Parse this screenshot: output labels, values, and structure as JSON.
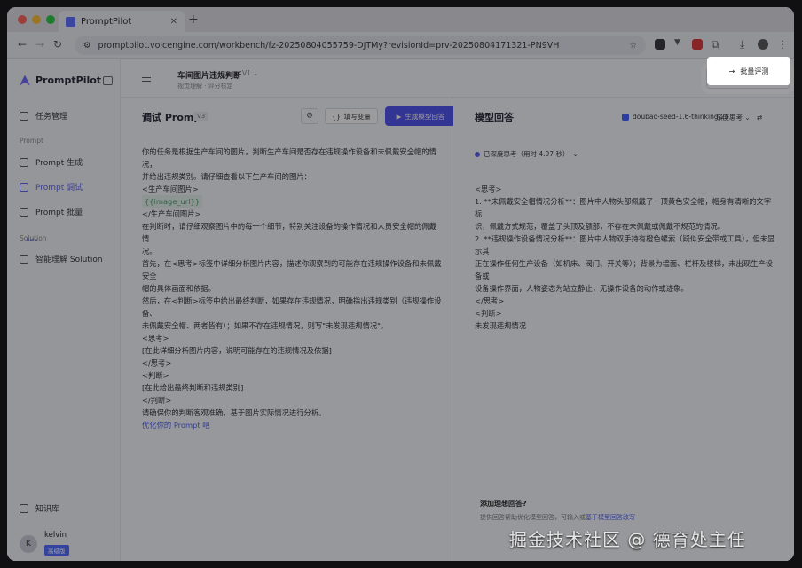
{
  "browser": {
    "tab_title": "PromptPilot",
    "url": "promptpilot.volcengine.com/workbench/fz-20250804055759-DJTMy?revisionId=prv-20250804171321-PN9VH"
  },
  "sidebar": {
    "brand": "PromptPilot",
    "items": [
      {
        "label": "任务管理"
      },
      {
        "label": "Prompt 生成"
      },
      {
        "label": "Prompt 调试"
      },
      {
        "label": "Prompt 批量"
      },
      {
        "label": "智能理解 Solution"
      },
      {
        "label": "知识库"
      }
    ],
    "sections": {
      "prompt": "Prompt",
      "solution": "Solution"
    },
    "beta": "beta",
    "user": {
      "name": "kelvin",
      "initial": "K",
      "badge": "高级版"
    }
  },
  "header": {
    "title": "车间图片违规判断",
    "version": "V1",
    "subtitle": "视觉理解 · 评分核定",
    "batch_button": "批量评测"
  },
  "left": {
    "title": "调试 Prompt",
    "version": "V3",
    "fill_vars": "填写变量",
    "generate": "生成模型回答",
    "lines": [
      "你的任务是根据生产车间的图片，判断生产车间是否存在违规操作设备和未佩戴安全帽的情况，",
      "并给出违规类别。请仔细查看以下生产车间的图片：",
      "<生产车间图片>",
      "{{image_url}}",
      "</生产车间图片>",
      "在判断时，请仔细观察图片中的每一个细节，特别关注设备的操作情况和人员安全帽的佩戴情",
      "况。",
      "首先，在<思考>标签中详细分析图片内容，描述你观察到的可能存在违规操作设备和未佩戴安全",
      "帽的具体画面和依据。",
      "然后，在<判断>标签中给出最终判断，如果存在违规情况，明确指出违规类别（违规操作设备、",
      "未佩戴安全帽、两者皆有）；如果不存在违规情况，则写\"未发现违规情况\"。",
      "<思考>",
      "[在此详细分析图片内容，说明可能存在的违规情况及依据]",
      "</思考>",
      "<判断>",
      "[在此给出最终判断和违规类别]",
      "</判断>",
      "请确保你的判断客观准确，基于图片实际情况进行分析。"
    ],
    "optimize_link": "优化你的 Prompt 吧"
  },
  "right": {
    "title": "模型回答",
    "model": "doubao-seed-1.6-thinking-25...",
    "mode": "深度思考",
    "think_label": "已深度思考（用时 4.97 秒）",
    "lines": [
      "<思考>",
      "1. **未佩戴安全帽情况分析**：图片中人物头部佩戴了一顶黄色安全帽，帽身有清晰的文字标",
      "识，佩戴方式规范，覆盖了头顶及额部，不存在未佩戴或佩戴不规范的情况。",
      "2. **违规操作设备情况分析**：图片中人物双手持有橙色螺索（疑似安全带或工具），但未显示其",
      "正在操作任何生产设备（如机床、阀门、开关等）；背景为墙面、栏杆及楼梯，未出现生产设备或",
      "设备操作界面，人物姿态为站立静止，无操作设备的动作或迹象。",
      "</思考>",
      "<判断>",
      "未发现违规情况"
    ],
    "feedback_title": "添加理想回答?",
    "feedback_text": "提供回答帮助优化模型回答，可输入或",
    "feedback_link": "基于模型回答改写"
  },
  "watermark": "掘金技术社区 @ 德育处主任",
  "colors": {
    "accent": "#4a4ff0",
    "overlay": "rgba(20,20,24,0.42)"
  }
}
